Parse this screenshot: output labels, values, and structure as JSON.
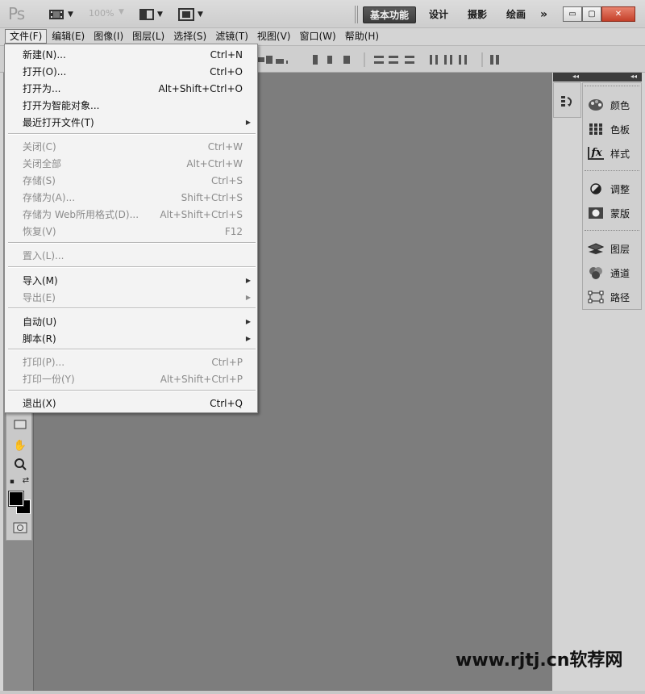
{
  "titlebar": {
    "logo": "Ps",
    "zoom": "100%",
    "workspaces": [
      "基本功能",
      "设计",
      "摄影",
      "绘画"
    ],
    "more": "»",
    "window_controls": {
      "minimize": "▭",
      "restore": "▢",
      "close": "✕"
    }
  },
  "menubar": {
    "items": [
      "文件(F)",
      "编辑(E)",
      "图像(I)",
      "图层(L)",
      "选择(S)",
      "滤镜(T)",
      "视图(V)",
      "窗口(W)",
      "帮助(H)"
    ]
  },
  "file_menu": {
    "items": [
      {
        "label": "新建(N)...",
        "shortcut": "Ctrl+N",
        "enabled": true,
        "submenu": false
      },
      {
        "label": "打开(O)...",
        "shortcut": "Ctrl+O",
        "enabled": true,
        "submenu": false
      },
      {
        "label": "打开为...",
        "shortcut": "Alt+Shift+Ctrl+O",
        "enabled": true,
        "submenu": false
      },
      {
        "label": "打开为智能对象...",
        "shortcut": "",
        "enabled": true,
        "submenu": false
      },
      {
        "label": "最近打开文件(T)",
        "shortcut": "",
        "enabled": true,
        "submenu": true
      },
      {
        "label": "关闭(C)",
        "shortcut": "Ctrl+W",
        "enabled": false,
        "submenu": false
      },
      {
        "label": "关闭全部",
        "shortcut": "Alt+Ctrl+W",
        "enabled": false,
        "submenu": false
      },
      {
        "label": "存储(S)",
        "shortcut": "Ctrl+S",
        "enabled": false,
        "submenu": false
      },
      {
        "label": "存储为(A)...",
        "shortcut": "Shift+Ctrl+S",
        "enabled": false,
        "submenu": false
      },
      {
        "label": "存储为 Web所用格式(D)...",
        "shortcut": "Alt+Shift+Ctrl+S",
        "enabled": false,
        "submenu": false
      },
      {
        "label": "恢复(V)",
        "shortcut": "F12",
        "enabled": false,
        "submenu": false
      },
      {
        "label": "置入(L)...",
        "shortcut": "",
        "enabled": false,
        "submenu": false
      },
      {
        "label": "导入(M)",
        "shortcut": "",
        "enabled": true,
        "submenu": true
      },
      {
        "label": "导出(E)",
        "shortcut": "",
        "enabled": false,
        "submenu": true
      },
      {
        "label": "自动(U)",
        "shortcut": "",
        "enabled": true,
        "submenu": true
      },
      {
        "label": "脚本(R)",
        "shortcut": "",
        "enabled": true,
        "submenu": true
      },
      {
        "label": "打印(P)...",
        "shortcut": "Ctrl+P",
        "enabled": false,
        "submenu": false
      },
      {
        "label": "打印一份(Y)",
        "shortcut": "Alt+Shift+Ctrl+P",
        "enabled": false,
        "submenu": false
      },
      {
        "label": "退出(X)",
        "shortcut": "Ctrl+Q",
        "enabled": true,
        "submenu": false
      }
    ]
  },
  "panels": {
    "items": [
      "颜色",
      "色板",
      "样式",
      "调整",
      "蒙版",
      "图层",
      "通道",
      "路径"
    ]
  },
  "watermark": "www.rjtj.cn软荐网"
}
